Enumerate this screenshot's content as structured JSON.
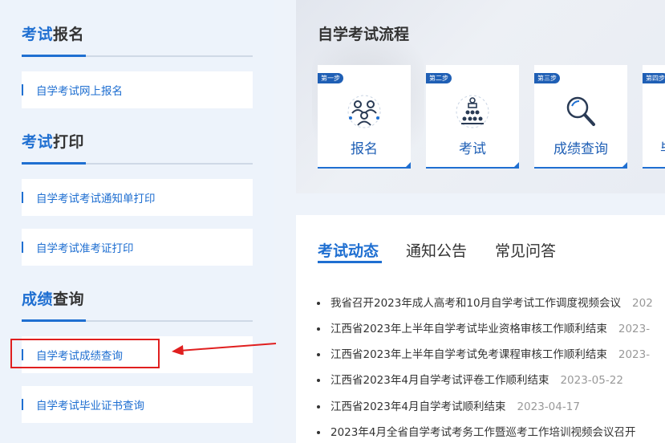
{
  "sidebar": {
    "signup": {
      "hl": "考试",
      "rest": "报名",
      "links": [
        "自学考试网上报名"
      ]
    },
    "print": {
      "hl": "考试",
      "rest": "打印",
      "links": [
        "自学考试考试通知单打印",
        "自学考试准考证打印"
      ]
    },
    "score": {
      "hl": "成绩",
      "rest": "查询",
      "links": [
        "自学考试成绩查询",
        "自学考试毕业证书查询"
      ]
    }
  },
  "annotation": {
    "highlight_color": "#e01f1f"
  },
  "process": {
    "title": "自学考试流程",
    "steps": [
      {
        "badge": "第一步",
        "label": "报名",
        "icon": "people-group-icon"
      },
      {
        "badge": "第二步",
        "label": "考试",
        "icon": "exam-hall-icon"
      },
      {
        "badge": "第三步",
        "label": "成绩查询",
        "icon": "magnifier-icon"
      },
      {
        "badge": "第四步",
        "label": "毕",
        "icon": "partial-step-icon"
      }
    ]
  },
  "news": {
    "tabs": [
      "考试动态",
      "通知公告",
      "常见问答"
    ],
    "active_tab": "考试动态",
    "items": [
      {
        "title": "我省召开2023年成人高考和10月自学考试工作调度视频会议",
        "date": "202"
      },
      {
        "title": "江西省2023年上半年自学考试毕业资格审核工作顺利结束",
        "date": "2023-"
      },
      {
        "title": "江西省2023年上半年自学考试免考课程审核工作顺利结束",
        "date": "2023-"
      },
      {
        "title": "江西省2023年4月自学考试评卷工作顺利结束",
        "date": "2023-05-22"
      },
      {
        "title": "江西省2023年4月自学考试顺利结束",
        "date": "2023-04-17"
      },
      {
        "title": "2023年4月全省自学考试考务工作暨巡考工作培训视频会议召开",
        "date": ""
      }
    ]
  },
  "colors": {
    "accent": "#1f6fd1",
    "badge": "#1f5fb5",
    "sidebar_bg": "#edf3fb"
  }
}
